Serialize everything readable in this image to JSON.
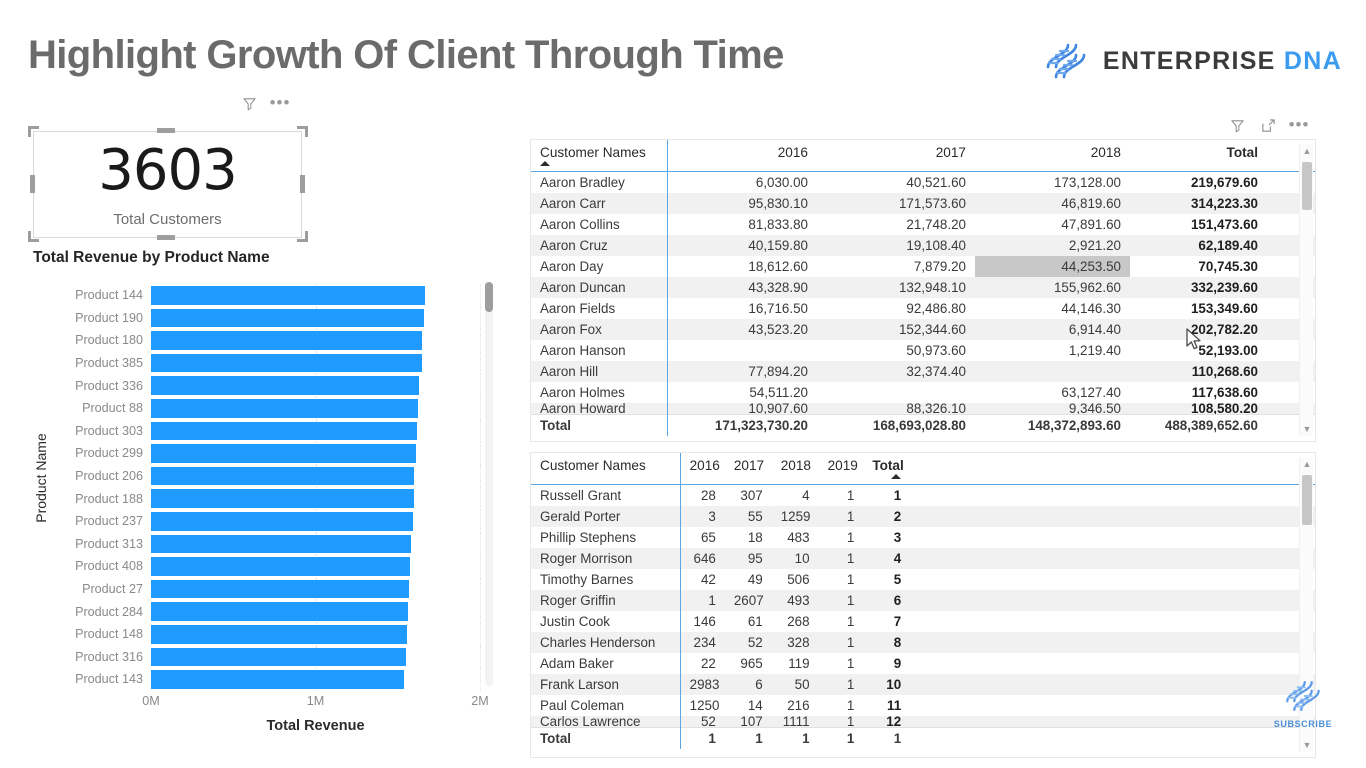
{
  "page": {
    "title": "Highlight Growth Of Client Through Time",
    "brand": {
      "primary": "ENTERPRISE",
      "secondary": "DNA",
      "icon": "dna-helix-icon"
    },
    "watermark": {
      "label": "SUBSCRIBE",
      "icon": "dna-helix-icon"
    },
    "accent_blue": "#1f9bff",
    "header_rule_blue": "#5aa8e8",
    "title_color": "#6b6b6b"
  },
  "card_visual": {
    "value": "3603",
    "label": "Total Customers",
    "icons": {
      "filter": "filter-icon",
      "more": "more-options-icon"
    }
  },
  "bar_visual": {
    "title": "Total Revenue by Product Name",
    "y_axis_title": "Product Name",
    "x_axis_title": "Total Revenue",
    "x_ticks": [
      "0M",
      "1M",
      "2M"
    ]
  },
  "chart_data": {
    "type": "bar",
    "title": "Total Revenue by Product Name",
    "xlabel": "Total Revenue",
    "ylabel": "Product Name",
    "orientation": "horizontal",
    "xlim": [
      0,
      2000000
    ],
    "xticks": [
      0,
      1000000,
      2000000
    ],
    "xticklabels": [
      "0M",
      "1M",
      "2M"
    ],
    "grid": true,
    "legend": "none",
    "color": "#1f9bff",
    "categories": [
      "Product 144",
      "Product 190",
      "Product 180",
      "Product 385",
      "Product 336",
      "Product 88",
      "Product 303",
      "Product 299",
      "Product 206",
      "Product 188",
      "Product 237",
      "Product 313",
      "Product 408",
      "Product 27",
      "Product 284",
      "Product 148",
      "Product 316",
      "Product 143"
    ],
    "values": [
      1663000,
      1658000,
      1650000,
      1648000,
      1630000,
      1625000,
      1620000,
      1610000,
      1600000,
      1598000,
      1592000,
      1580000,
      1572000,
      1568000,
      1562000,
      1558000,
      1552000,
      1540000
    ]
  },
  "matrix_top": {
    "icons": {
      "filter": "filter-icon",
      "focus": "focus-mode-icon",
      "more": "more-options-icon"
    },
    "columns": [
      "Customer Names",
      "2016",
      "2017",
      "2018",
      "Total"
    ],
    "sorted_column": "Customer Names",
    "sort_direction": "ascending",
    "rows": [
      {
        "name": "Aaron Bradley",
        "v2016": "6,030.00",
        "v2017": "40,521.60",
        "v2018": "173,128.00",
        "total": "219,679.60"
      },
      {
        "name": "Aaron Carr",
        "v2016": "95,830.10",
        "v2017": "171,573.60",
        "v2018": "46,819.60",
        "total": "314,223.30"
      },
      {
        "name": "Aaron Collins",
        "v2016": "81,833.80",
        "v2017": "21,748.20",
        "v2018": "47,891.60",
        "total": "151,473.60"
      },
      {
        "name": "Aaron Cruz",
        "v2016": "40,159.80",
        "v2017": "19,108.40",
        "v2018": "2,921.20",
        "total": "62,189.40"
      },
      {
        "name": "Aaron Day",
        "v2016": "18,612.60",
        "v2017": "7,879.20",
        "v2018": "44,253.50",
        "total": "70,745.30",
        "highlight": "v2018"
      },
      {
        "name": "Aaron Duncan",
        "v2016": "43,328.90",
        "v2017": "132,948.10",
        "v2018": "155,962.60",
        "total": "332,239.60"
      },
      {
        "name": "Aaron Fields",
        "v2016": "16,716.50",
        "v2017": "92,486.80",
        "v2018": "44,146.30",
        "total": "153,349.60"
      },
      {
        "name": "Aaron Fox",
        "v2016": "43,523.20",
        "v2017": "152,344.60",
        "v2018": "6,914.40",
        "total": "202,782.20"
      },
      {
        "name": "Aaron Hanson",
        "v2016": "",
        "v2017": "50,973.60",
        "v2018": "1,219.40",
        "total": "52,193.00"
      },
      {
        "name": "Aaron Hill",
        "v2016": "77,894.20",
        "v2017": "32,374.40",
        "v2018": "",
        "total": "110,268.60"
      },
      {
        "name": "Aaron Holmes",
        "v2016": "54,511.20",
        "v2017": "",
        "v2018": "63,127.40",
        "total": "117,638.60"
      },
      {
        "name": "Aaron Howard",
        "v2016": "10,907.60",
        "v2017": "88,326.10",
        "v2018": "9,346.50",
        "total": "108,580.20"
      }
    ],
    "total_row": {
      "name": "Total",
      "v2016": "171,323,730.20",
      "v2017": "168,693,028.80",
      "v2018": "148,372,893.60",
      "total": "488,389,652.60"
    }
  },
  "matrix_bottom": {
    "columns": [
      "Customer Names",
      "2016",
      "2017",
      "2018",
      "2019",
      "Total"
    ],
    "sorted_column": "Total",
    "sort_direction": "ascending",
    "rows": [
      {
        "name": "Russell Grant",
        "v2016": "28",
        "v2017": "307",
        "v2018": "4",
        "v2019": "1",
        "total": "1"
      },
      {
        "name": "Gerald Porter",
        "v2016": "3",
        "v2017": "55",
        "v2018": "1259",
        "v2019": "1",
        "total": "2"
      },
      {
        "name": "Phillip Stephens",
        "v2016": "65",
        "v2017": "18",
        "v2018": "483",
        "v2019": "1",
        "total": "3"
      },
      {
        "name": "Roger Morrison",
        "v2016": "646",
        "v2017": "95",
        "v2018": "10",
        "v2019": "1",
        "total": "4"
      },
      {
        "name": "Timothy Barnes",
        "v2016": "42",
        "v2017": "49",
        "v2018": "506",
        "v2019": "1",
        "total": "5"
      },
      {
        "name": "Roger Griffin",
        "v2016": "1",
        "v2017": "2607",
        "v2018": "493",
        "v2019": "1",
        "total": "6"
      },
      {
        "name": "Justin Cook",
        "v2016": "146",
        "v2017": "61",
        "v2018": "268",
        "v2019": "1",
        "total": "7"
      },
      {
        "name": "Charles Henderson",
        "v2016": "234",
        "v2017": "52",
        "v2018": "328",
        "v2019": "1",
        "total": "8"
      },
      {
        "name": "Adam Baker",
        "v2016": "22",
        "v2017": "965",
        "v2018": "119",
        "v2019": "1",
        "total": "9"
      },
      {
        "name": "Frank Larson",
        "v2016": "2983",
        "v2017": "6",
        "v2018": "50",
        "v2019": "1",
        "total": "10"
      },
      {
        "name": "Paul Coleman",
        "v2016": "1250",
        "v2017": "14",
        "v2018": "216",
        "v2019": "1",
        "total": "11"
      },
      {
        "name": "Carlos Lawrence",
        "v2016": "52",
        "v2017": "107",
        "v2018": "1111",
        "v2019": "1",
        "total": "12"
      }
    ],
    "total_row": {
      "name": "Total",
      "v2016": "1",
      "v2017": "1",
      "v2018": "1",
      "v2019": "1",
      "total": "1"
    }
  }
}
